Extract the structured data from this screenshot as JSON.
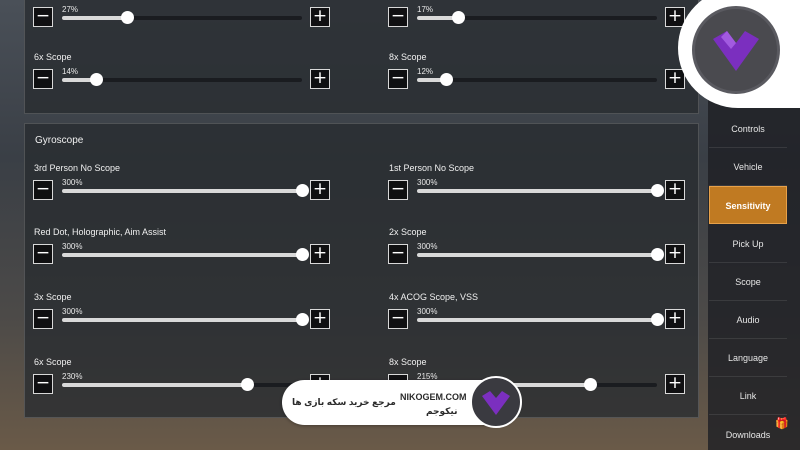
{
  "top_section": {
    "rows": [
      {
        "label": "",
        "value": "27%",
        "fraction": 0.27
      },
      {
        "label": "",
        "value": "17%",
        "fraction": 0.17
      },
      {
        "label": "6x Scope",
        "value": "14%",
        "fraction": 0.14
      },
      {
        "label": "8x Scope",
        "value": "12%",
        "fraction": 0.12
      }
    ]
  },
  "gyroscope": {
    "title": "Gyroscope",
    "rows": [
      {
        "label": "3rd Person No Scope",
        "value": "300%",
        "fraction": 1.0
      },
      {
        "label": "1st Person No Scope",
        "value": "300%",
        "fraction": 1.0
      },
      {
        "label": "Red Dot, Holographic, Aim Assist",
        "value": "300%",
        "fraction": 1.0
      },
      {
        "label": "2x Scope",
        "value": "300%",
        "fraction": 1.0
      },
      {
        "label": "3x Scope",
        "value": "300%",
        "fraction": 1.0
      },
      {
        "label": "4x ACOG Scope, VSS",
        "value": "300%",
        "fraction": 1.0
      },
      {
        "label": "6x Scope",
        "value": "230%",
        "fraction": 0.77
      },
      {
        "label": "8x Scope",
        "value": "215%",
        "fraction": 0.72
      }
    ]
  },
  "buttons": {
    "minus": "−",
    "plus": "+"
  },
  "sidebar": {
    "items": [
      {
        "label": "Controls",
        "active": false
      },
      {
        "label": "Vehicle",
        "active": false
      },
      {
        "label": "Sensitivity",
        "active": true
      },
      {
        "label": "Pick Up",
        "active": false
      },
      {
        "label": "Scope",
        "active": false
      },
      {
        "label": "Audio",
        "active": false
      },
      {
        "label": "Language",
        "active": false
      },
      {
        "label": "Link",
        "active": false
      },
      {
        "label": "Downloads",
        "active": false
      }
    ],
    "accent_color": "#c07a22"
  },
  "watermark": {
    "site": "NIKOGEM.COM",
    "slogan": "مرجع خرید سکه بازی ها",
    "brand": "نیکوجم",
    "logo_color": "#7b2fbf"
  }
}
